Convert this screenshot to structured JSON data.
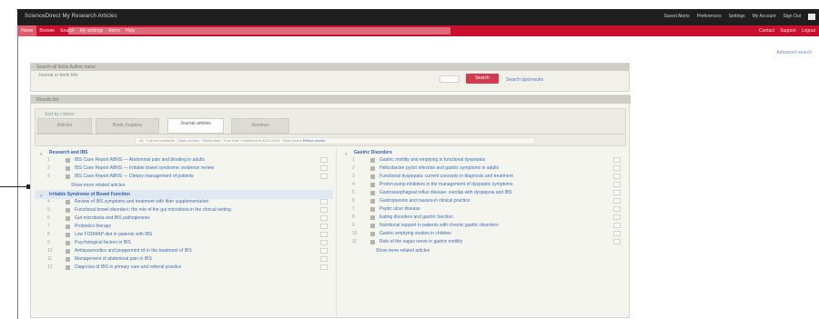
{
  "app": {
    "brand": "ScienceDirect   My Research   Articles"
  },
  "top_links": [
    "Saved Alerts",
    "Preferences",
    "Settings",
    "My Account",
    "Sign Out"
  ],
  "nav": {
    "items": [
      "Home",
      "Browse",
      "Search",
      "My settings",
      "Alerts",
      "Help"
    ],
    "active": "Home",
    "right_links": [
      "Contact",
      "Support",
      "Logout"
    ]
  },
  "right_link": "Advanced search",
  "search_panel": {
    "header": "Search all fields  Author name",
    "subheader": "Journal or book title",
    "search_button": "Search",
    "help_link": "Search tips/results"
  },
  "results_panel": {
    "header": "Results list",
    "options_label": "Sort by / show:",
    "tabs": [
      {
        "label": "Articles",
        "active": false
      },
      {
        "label": "Book chapters",
        "active": false
      },
      {
        "label": "Journal articles",
        "active": true
      },
      {
        "label": "Reviews",
        "active": false
      }
    ],
    "filters_text": "All  ·  Full text available  ·  Open access  ·  Subscribed  ·  Free trial  ·  Published in 2014-2015  ·  Most recent",
    "filters_link": "Refine results"
  },
  "left_column": {
    "sections": [
      {
        "title": "Research and IBS",
        "band": false,
        "rows": [
          {
            "num": "1",
            "text": "IBS Case Report ABNS — Abdominal pain and bloating in adults"
          },
          {
            "num": "2",
            "text": "IBS Case Report ABNS — Irritable bowel syndrome: evidence review"
          },
          {
            "num": "3",
            "text": "IBS Case Report ABNS — Dietary management of patients"
          }
        ],
        "more": "Show more related articles"
      },
      {
        "title": "Irritable Syndrome of Bowel Function",
        "band": true,
        "rows": [
          {
            "num": "4",
            "text": "Review of IBS symptoms and treatment with fiber supplementation"
          },
          {
            "num": "5",
            "text": "Functional bowel disorders: the role of the gut microbiota in the clinical setting"
          },
          {
            "num": "6",
            "text": "Gut microbiota and IBS pathogenesis"
          },
          {
            "num": "7",
            "text": "Probiotics therapy"
          },
          {
            "num": "8",
            "text": "Low FODMAP diet in patients with IBS"
          },
          {
            "num": "9",
            "text": "Psychological factors in IBS"
          },
          {
            "num": "10",
            "text": "Antispasmodics and peppermint oil in the treatment of IBS"
          },
          {
            "num": "11",
            "text": "Management of abdominal pain in IBS"
          },
          {
            "num": "12",
            "text": "Diagnosis of IBS in primary care and referral practice"
          }
        ]
      }
    ]
  },
  "right_column": {
    "sections": [
      {
        "title": "Gastric Disorders",
        "band": false,
        "rows": [
          {
            "num": "1",
            "text": "Gastric motility and emptying in functional dyspepsia"
          },
          {
            "num": "2",
            "text": "Helicobacter pylori infection and gastric symptoms in adults"
          },
          {
            "num": "3",
            "text": "Functional dyspepsia: current concepts in diagnosis and treatment"
          },
          {
            "num": "4",
            "text": "Proton pump inhibitors in the management of dyspeptic symptoms"
          },
          {
            "num": "5",
            "text": "Gastroesophageal reflux disease: overlap with dyspepsia and IBS"
          },
          {
            "num": "6",
            "text": "Gastroparesis and nausea in clinical practice"
          },
          {
            "num": "7",
            "text": "Peptic ulcer disease"
          },
          {
            "num": "8",
            "text": "Eating disorders and gastric function"
          },
          {
            "num": "9",
            "text": "Nutritional support in patients with chronic gastric disorders"
          },
          {
            "num": "10",
            "text": "Gastric emptying studies in children"
          },
          {
            "num": "11",
            "text": "Role of the vagus nerve in gastric motility"
          }
        ],
        "more": "Show more related articles"
      }
    ]
  }
}
